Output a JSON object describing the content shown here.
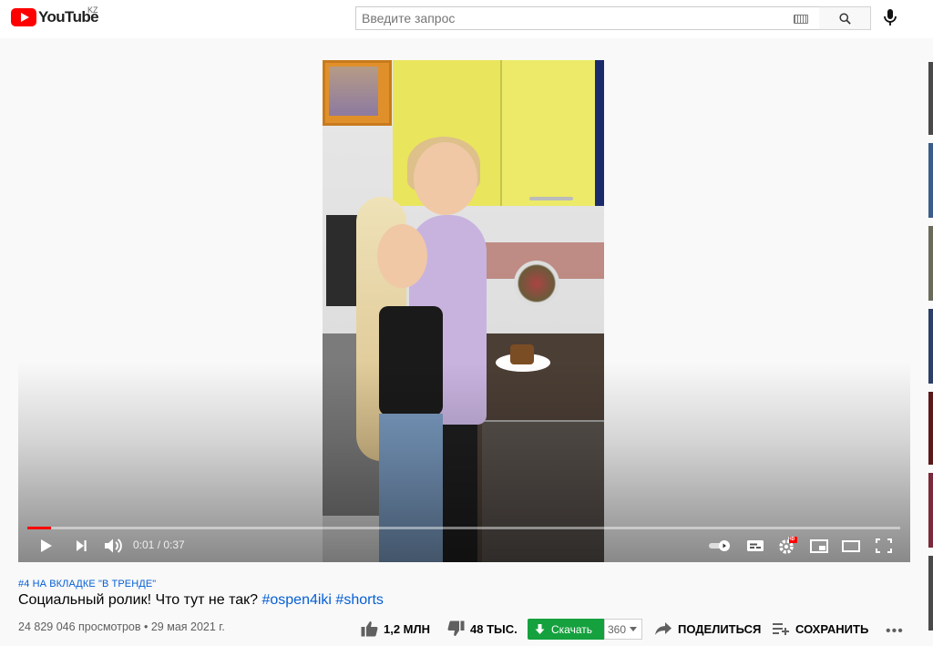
{
  "header": {
    "logo_text": "YouTube",
    "country": "KZ",
    "search_placeholder": "Введите запрос",
    "icons": [
      "youtube-logo-icon",
      "keyboard-icon",
      "search-icon",
      "microphone-icon"
    ]
  },
  "player": {
    "time": "0:01 / 0:37",
    "progress": 0.027,
    "hd_badge": "HD",
    "colors": {
      "progress": "#ff0000",
      "scrubber_track": "rgba(255,255,255,0.45)"
    },
    "controls": [
      "play-icon",
      "next-icon",
      "volume-icon",
      "autoplay-toggle",
      "subtitles-icon",
      "settings-icon",
      "miniplayer-icon",
      "theater-icon",
      "fullscreen-icon"
    ]
  },
  "video": {
    "trending_badge": "#4 НА ВКЛАДКЕ \"В ТРЕНДЕ\"",
    "title_text": "Социальный ролик! Что тут не так?",
    "hashtags": [
      "#ospen4iki",
      "#shorts"
    ],
    "views": "24 829 046 просмотров",
    "separator": "•",
    "date": "29 мая 2021 г.",
    "likes": "1,2 МЛН",
    "dislikes": "48 ТЫС.",
    "download_label": "Скачать",
    "quality": "360",
    "share_label": "ПОДЕЛИТЬСЯ",
    "save_label": "СОХРАНИТЬ",
    "more": "•••",
    "colors": {
      "link": "#065fd4",
      "download_bg": "#15a13e"
    }
  }
}
